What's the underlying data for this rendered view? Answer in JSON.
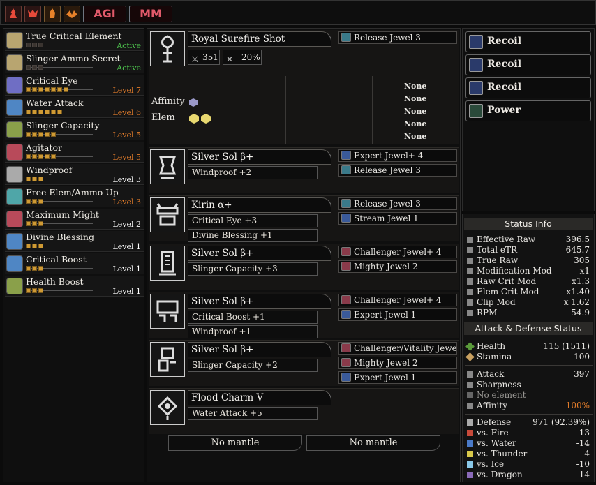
{
  "topbar": {
    "buttons": [
      "AGI",
      "MM"
    ]
  },
  "skills": [
    {
      "name": "True Critical Element",
      "level": "Active",
      "color": "#4fc94f",
      "pips": 0,
      "max": 0,
      "icon": "#b8a570"
    },
    {
      "name": "Slinger Ammo Secret",
      "level": "Active",
      "color": "#4fc94f",
      "pips": 0,
      "max": 0,
      "icon": "#b8a570"
    },
    {
      "name": "Critical Eye",
      "level": "Level 7",
      "color": "#e07b2a",
      "pips": 7,
      "max": 7,
      "icon": "#6f6ec4"
    },
    {
      "name": "Water Attack",
      "level": "Level 6",
      "color": "#e07b2a",
      "pips": 6,
      "max": 6,
      "icon": "#4f86c4"
    },
    {
      "name": "Slinger Capacity",
      "level": "Level 5",
      "color": "#e07b2a",
      "pips": 5,
      "max": 5,
      "icon": "#8aa04a"
    },
    {
      "name": "Agitator",
      "level": "Level 5",
      "color": "#e07b2a",
      "pips": 5,
      "max": 5,
      "icon": "#b84a5a"
    },
    {
      "name": "Windproof",
      "level": "Level 3",
      "color": "#ffffff",
      "pips": 3,
      "max": 3,
      "icon": "#aaaaaa"
    },
    {
      "name": "Free Elem/Ammo Up",
      "level": "Level 3",
      "color": "#e07b2a",
      "pips": 3,
      "max": 3,
      "icon": "#4fa6a8"
    },
    {
      "name": "Maximum Might",
      "level": "Level 2",
      "color": "#ffffff",
      "pips": 2,
      "max": 3,
      "icon": "#b84a5a"
    },
    {
      "name": "Divine Blessing",
      "level": "Level 1",
      "color": "#ffffff",
      "pips": 1,
      "max": 3,
      "icon": "#4f86c4"
    },
    {
      "name": "Critical Boost",
      "level": "Level 1",
      "color": "#ffffff",
      "pips": 1,
      "max": 3,
      "icon": "#4f86c4"
    },
    {
      "name": "Health Boost",
      "level": "Level 1",
      "color": "#ffffff",
      "pips": 1,
      "max": 3,
      "icon": "#8aa04a"
    }
  ],
  "weapon": {
    "name": "Royal Surefire Shot",
    "attack": "351",
    "affinity": "20%",
    "affinity_label": "Affinity",
    "elem_label": "Elem",
    "jewel": "Release Jewel 3",
    "mods": [
      "None",
      "None",
      "None",
      "None",
      "None"
    ]
  },
  "armor": [
    {
      "name": "Silver Sol β+",
      "skills": [
        "Windproof +2"
      ],
      "jewels": [
        "Expert Jewel+ 4",
        "Release Jewel 3"
      ]
    },
    {
      "name": "Kirin α+",
      "skills": [
        "Critical Eye +3",
        "Divine Blessing +1"
      ],
      "jewels": [
        "Release Jewel 3",
        "Stream Jewel 1"
      ]
    },
    {
      "name": "Silver Sol β+",
      "skills": [
        "Slinger Capacity +3"
      ],
      "jewels": [
        "Challenger Jewel+ 4",
        "Mighty Jewel 2"
      ]
    },
    {
      "name": "Silver Sol β+",
      "skills": [
        "Critical Boost +1",
        "Windproof +1"
      ],
      "jewels": [
        "Challenger Jewel+ 4",
        "Expert Jewel 1"
      ]
    },
    {
      "name": "Silver Sol β+",
      "skills": [
        "Slinger Capacity +2"
      ],
      "jewels": [
        "Challenger/Vitality Jewel",
        "Mighty Jewel 2",
        "Expert Jewel 1"
      ]
    },
    {
      "name": "Flood Charm V",
      "skills": [
        "Water Attack +5"
      ],
      "jewels": []
    }
  ],
  "mantles": [
    "No mantle",
    "No mantle"
  ],
  "decorations": [
    "Recoil",
    "Recoil",
    "Recoil",
    "Power"
  ],
  "status": {
    "title": "Status Info",
    "rows": [
      [
        "Effective Raw",
        "396.5"
      ],
      [
        "Total eTR",
        "645.7"
      ],
      [
        "True Raw",
        "305"
      ],
      [
        "Modification Mod",
        "x1"
      ],
      [
        "Raw Crit Mod",
        "x1.3"
      ],
      [
        "Elem Crit Mod",
        "x1.40"
      ],
      [
        "Clip Mod",
        "x 1.62"
      ],
      [
        "RPM",
        "54.9"
      ]
    ],
    "section2": "Attack & Defense Status",
    "health": [
      "Health",
      "115 (1511)"
    ],
    "stamina": [
      "Stamina",
      "100"
    ],
    "attack": [
      "Attack",
      "397"
    ],
    "sharpness": "Sharpness",
    "element": "No element",
    "affinity": [
      "Affinity",
      "100%"
    ],
    "defense": [
      [
        "Defense",
        "971 (92.39%)"
      ],
      [
        "vs. Fire",
        "13"
      ],
      [
        "vs. Water",
        "-14"
      ],
      [
        "vs. Thunder",
        "-4"
      ],
      [
        "vs. Ice",
        "-10"
      ],
      [
        "vs. Dragon",
        "14"
      ]
    ]
  },
  "colors": {
    "accent_orange": "#e07b2a",
    "active_green": "#4fc94f",
    "topbtn_text": "#e05a6a"
  }
}
